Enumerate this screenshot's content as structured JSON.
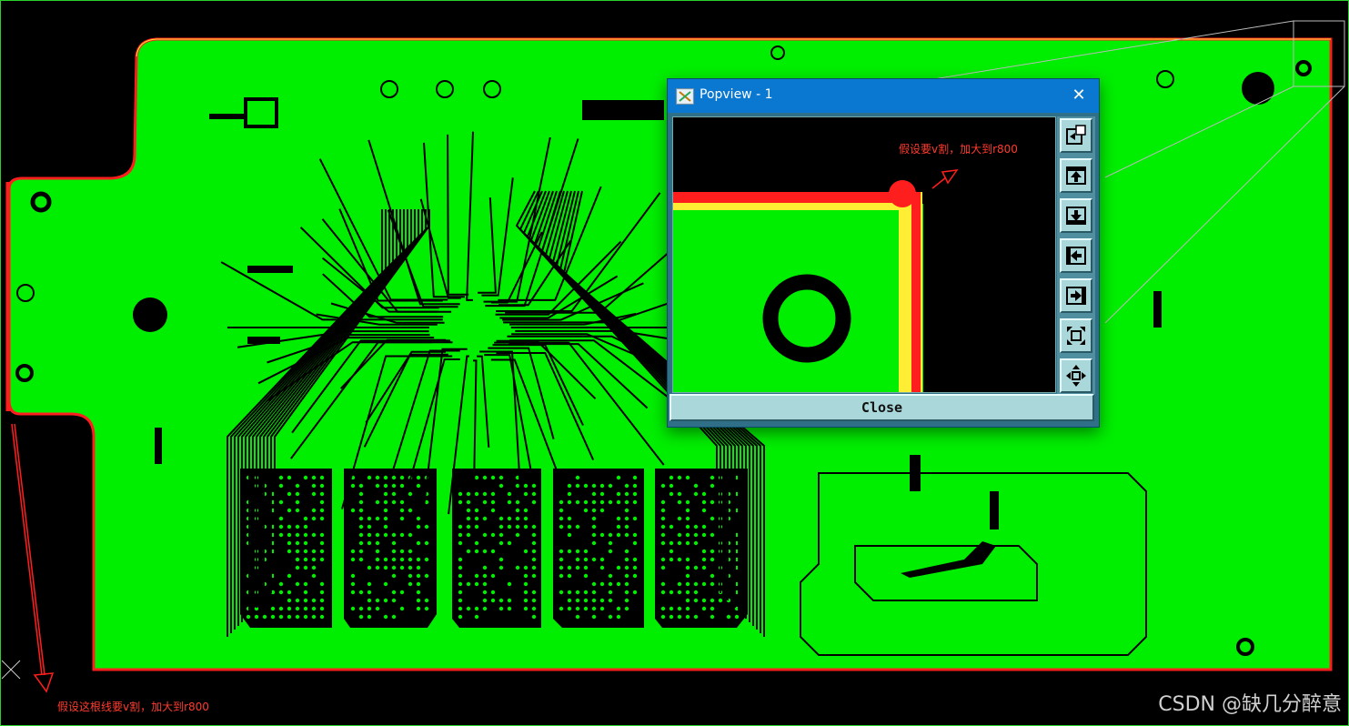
{
  "popview": {
    "title": "Popview - 1",
    "close_x": "✕",
    "annotation": "假设要v割，加大到r800",
    "close_button": "Close"
  },
  "annotation_bottom": "假设这根线要v割，加大到r800",
  "watermark": "CSDN @缺几分醉意",
  "colors": {
    "board_fill": "#00ee00",
    "outline_red": "#ff1e1e",
    "outline_yellow": "#ffee33",
    "trace": "#000000",
    "dialog_title": "#0a78d1",
    "tool_button": "#a9d7da"
  },
  "toolbar_tools": [
    "zoom-fit-icon",
    "move-up-icon",
    "move-down-icon",
    "move-left-icon",
    "move-right-icon",
    "zoom-in-icon",
    "zoom-out-icon"
  ]
}
